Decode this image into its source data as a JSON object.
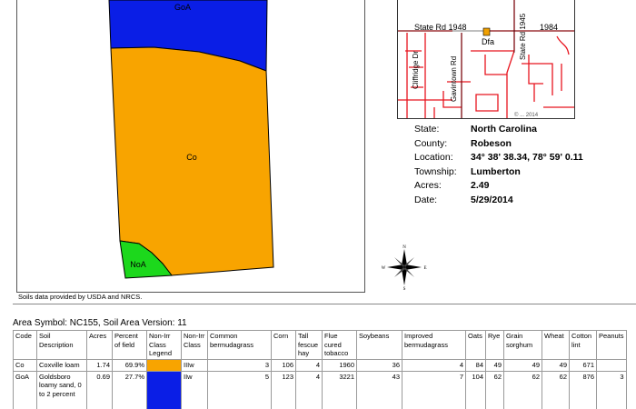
{
  "map": {
    "units": [
      {
        "symbol": "GoA",
        "color": "#0a1ee6"
      },
      {
        "symbol": "Co",
        "color": "#f8a400"
      },
      {
        "symbol": "NoA",
        "color": "#1cd81c"
      }
    ],
    "source_note": "Soils data provided by USDA and NRCS."
  },
  "inset": {
    "roads": {
      "state_rd_1948": "State Rd 1948",
      "state_rd_1945": "State Rd 1945",
      "rd_1984": "1984",
      "cliffridge": "Cliffridge Dr",
      "gavintown": "Gavintown Rd"
    },
    "marker_label": "Dfa",
    "marker_color": "#f0a000",
    "road_color": "#e8141e",
    "copyright": "© ... 2014"
  },
  "info": {
    "rows": [
      {
        "key": "State:",
        "value": "North Carolina"
      },
      {
        "key": "County:",
        "value": "Robeson"
      },
      {
        "key": "Location:",
        "value": "34° 38' 38.34,  78° 59' 0.11"
      },
      {
        "key": "Township:",
        "value": "Lumberton"
      },
      {
        "key": "Acres:",
        "value": "2.49"
      },
      {
        "key": "Date:",
        "value": "5/29/2014"
      }
    ]
  },
  "compass": {
    "n": "N",
    "s": "S",
    "e": "E",
    "w": "W"
  },
  "table": {
    "area_title": "Area Symbol: NC155, Soil Area Version: 11",
    "headers": [
      "Code",
      "Soil Description",
      "Acres",
      "Percent of field",
      "Non-Irr Class Legend",
      "Non-Irr Class",
      "Common bermudagrass",
      "Corn",
      "Tall fescue hay",
      "Flue cured tobacco",
      "Soybeans",
      "Improved bermudagrass",
      "Oats",
      "Rye",
      "Grain sorghum",
      "Wheat",
      "Cotton lint",
      "Peanuts"
    ],
    "rows": [
      {
        "code": "Co",
        "desc": "Coxville loam",
        "acres": "1.74",
        "percent": "69.9%",
        "legend_color": "#f8a400",
        "class": "IIIw",
        "common_bermuda": "3",
        "corn": "106",
        "fescue": "4",
        "tobacco": "1960",
        "soybeans": "36",
        "improved_bermuda": "4",
        "oats": "84",
        "rye": "49",
        "sorghum": "49",
        "wheat": "49",
        "cotton": "671",
        "peanuts": ""
      },
      {
        "code": "GoA",
        "desc": "Goldsboro loamy sand, 0 to 2 percent",
        "acres": "0.69",
        "percent": "27.7%",
        "legend_color": "#0a1ee6",
        "class": "IIw",
        "common_bermuda": "5",
        "corn": "123",
        "fescue": "4",
        "tobacco": "3221",
        "soybeans": "43",
        "improved_bermuda": "7",
        "oats": "104",
        "rye": "62",
        "sorghum": "62",
        "wheat": "62",
        "cotton": "876",
        "peanuts": "3"
      }
    ]
  }
}
